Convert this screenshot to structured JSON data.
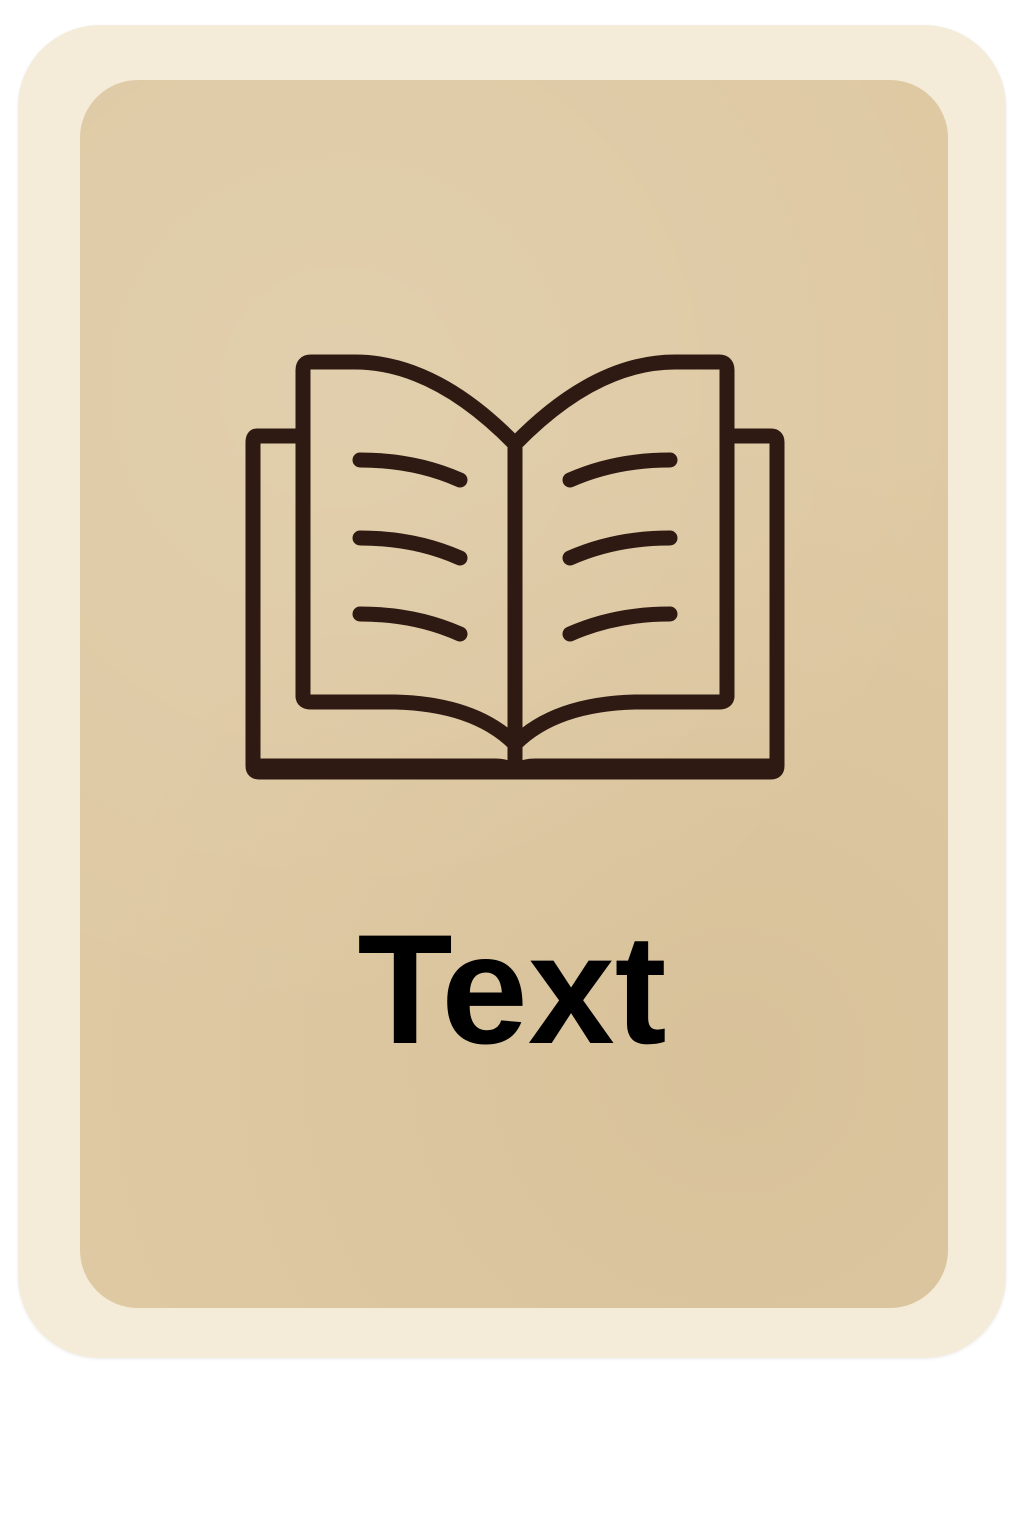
{
  "card": {
    "label": "Text",
    "icon": "open-book-icon"
  },
  "colors": {
    "outer_border": "#f4ecd9",
    "inner_panel": "#dec9a3",
    "icon_stroke": "#2e1a12",
    "label_text": "#000000"
  }
}
